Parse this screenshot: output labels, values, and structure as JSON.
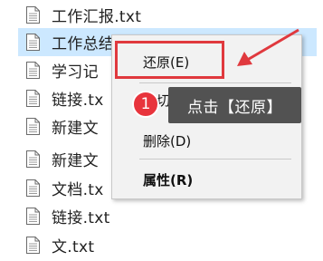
{
  "files": [
    {
      "name": "工作汇报.txt",
      "icon": "text-file-icon"
    },
    {
      "name": "工作总结.txt",
      "icon": "text-file-icon",
      "selected": true
    },
    {
      "name": "学习记",
      "icon": "text-file-icon"
    },
    {
      "name": "链接.tx",
      "icon": "text-file-icon"
    },
    {
      "name": "新建文",
      "icon": "text-file-icon"
    },
    {
      "name": "新建文",
      "icon": "text-file-icon"
    },
    {
      "name": "文档.tx",
      "icon": "text-file-icon"
    },
    {
      "name": "链接.txt",
      "icon": "text-file-icon"
    },
    {
      "name": "文.txt",
      "icon": "text-file-icon"
    }
  ],
  "context_menu": {
    "restore": "还原(E)",
    "cut": "剪切(T)",
    "delete": "删除(D)",
    "properties": "属性(R)"
  },
  "annotation": {
    "step_number": "1",
    "tooltip": "点击【还原】",
    "highlight_color": "#e0393e"
  }
}
